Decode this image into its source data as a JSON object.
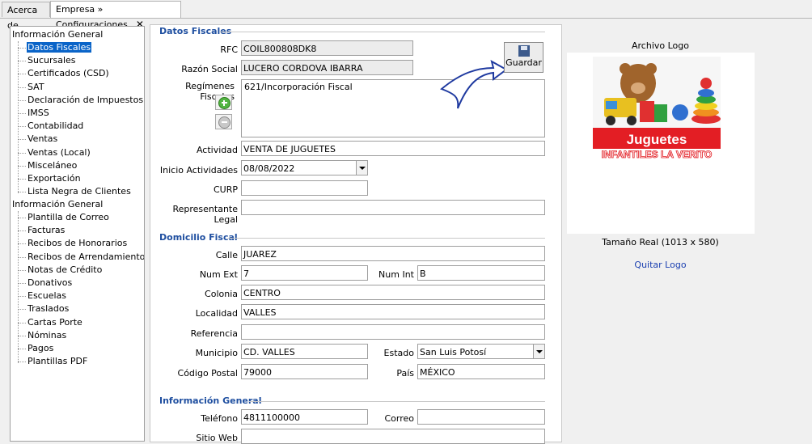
{
  "tabs": [
    {
      "label": "Acerca de"
    },
    {
      "label": "Empresa » Configuraciones",
      "close": "✕"
    }
  ],
  "tree": {
    "group1": "Información General",
    "group1_items": [
      "Datos Fiscales",
      "Sucursales",
      "Certificados (CSD)",
      "SAT",
      "Declaración de Impuestos",
      "IMSS",
      "Contabilidad",
      "Ventas",
      "Ventas (Local)",
      "Misceláneo",
      "Exportación",
      "Lista Negra de Clientes"
    ],
    "group2": "Información General",
    "group2_items": [
      "Plantilla de Correo",
      "Facturas",
      "Recibos de Honorarios",
      "Recibos de Arrendamiento",
      "Notas de Crédito",
      "Donativos",
      "Escuelas",
      "Traslados",
      "Cartas Porte",
      "Nóminas",
      "Pagos",
      "Plantillas PDF"
    ],
    "selected": "Datos Fiscales"
  },
  "datos_fiscales": {
    "title": "Datos Fiscales",
    "rfc_label": "RFC",
    "rfc": "COIL800808DK8",
    "razon_label": "Razón Social",
    "razon": "LUCERO CORDOVA IBARRA",
    "regimenes_label": "Regímenes Fiscales",
    "regimen": "621/Incorporación Fiscal",
    "actividad_label": "Actividad",
    "actividad": "VENTA DE JUGUETES",
    "inicio_label": "Inicio Actividades",
    "inicio": "08/08/2022",
    "curp_label": "CURP",
    "curp": "",
    "rep_label": "Representante Legal",
    "rep": ""
  },
  "domicilio": {
    "title": "Domicilio Fiscal",
    "calle_label": "Calle",
    "calle": "JUAREZ",
    "numext_label": "Num Ext",
    "numext": "7",
    "numint_label": "Num Int",
    "numint": "B",
    "colonia_label": "Colonia",
    "colonia": "CENTRO",
    "localidad_label": "Localidad",
    "localidad": "VALLES",
    "referencia_label": "Referencia",
    "referencia": "",
    "municipio_label": "Municipio",
    "municipio": "CD. VALLES",
    "estado_label": "Estado",
    "estado": "San Luis Potosí",
    "cp_label": "Código Postal",
    "cp": "79000",
    "pais_label": "País",
    "pais": "MÉXICO"
  },
  "info_general": {
    "title": "Información General",
    "telefono_label": "Teléfono",
    "telefono": "4811100000",
    "correo_label": "Correo",
    "correo": "",
    "web_label": "Sitio Web",
    "web": ""
  },
  "guardar_label": "Guardar",
  "logo": {
    "title": "Archivo Logo",
    "text1": "Juguetes",
    "text2": "INFANTILES LA VERITO",
    "size": "Tamaño Real (1013 x 580)",
    "remove": "Quitar Logo"
  },
  "colors": {
    "accent": "#1f4fa0",
    "selection": "#0a64c8",
    "logo_red": "#e31e24",
    "arrow": "#1f3aa0"
  }
}
